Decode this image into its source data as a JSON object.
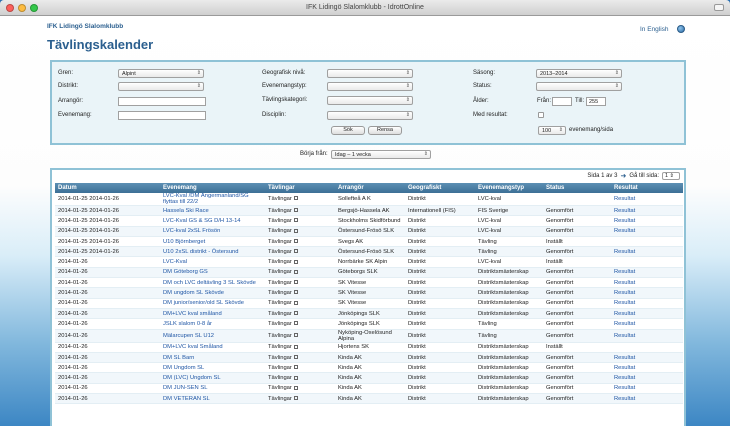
{
  "window": {
    "title": "IFK Lidingö Slalomklubb - IdrottOnline"
  },
  "header": {
    "club": "IFK Lidingö Slalomklubb",
    "page_title": "Tävlingskalender",
    "language_link": "In English"
  },
  "filters": {
    "gren_label": "Gren:",
    "gren_value": "Alpint",
    "distrikt_label": "Distrikt:",
    "arrangor_label": "Arrangör:",
    "evenemang_label": "Evenemang:",
    "geografisk_label": "Geografisk nivå:",
    "evenemangstyp_label": "Evenemangstyp:",
    "tavlingskategori_label": "Tävlingskategori:",
    "disciplin_label": "Disciplin:",
    "sasong_label": "Säsong:",
    "sasong_value": "2013–2014",
    "status_label": "Status:",
    "alder_label": "Ålder:",
    "fran_label": "Från:",
    "till_label": "Till:",
    "till_value": "255",
    "med_resultat_label": "Med resultat:",
    "per_page_value": "100",
    "per_page_label": "evenemang/sida",
    "search_button": "Sök",
    "reset_button": "Rensa"
  },
  "start": {
    "label": "Börja från:",
    "value": "Idag – 1 vecka"
  },
  "pagination": {
    "info": "Sida 1 av 3",
    "goto_label": "Gå till sida:",
    "page_value": "1"
  },
  "table": {
    "headers": [
      "Datum",
      "Evenemang",
      "Tävlingar",
      "Arrangör",
      "Geografiskt",
      "Evenemangstyp",
      "Status",
      "Resultat"
    ],
    "tavlingar_text": "Tävlingar",
    "rows": [
      {
        "date": "2014-01-25 2014-01-26",
        "event": "LVC-Kval /DM Ångermanland/SG flyttas till 22/2",
        "org": "Sollefteå A K",
        "geo": "Distrikt",
        "type": "LVC-kval",
        "status": "",
        "result": "Resultat"
      },
      {
        "date": "2014-01-25 2014-01-26",
        "event": "Hassela Ski Race",
        "org": "Bergsjö-Hassela AK",
        "geo": "Internationell (FIS)",
        "type": "FIS Sverige",
        "status": "Genomfört",
        "result": "Resultat"
      },
      {
        "date": "2014-01-25 2014-01-26",
        "event": "LVC-Kval GS & SG D/H 13-14",
        "org": "Stockholms Skidförbund",
        "geo": "Distrikt",
        "type": "LVC-kval",
        "status": "Genomfört",
        "result": "Resultat"
      },
      {
        "date": "2014-01-25 2014-01-26",
        "event": "LVC-kval 2xSL Frösön",
        "org": "Östersund-Frösö SLK",
        "geo": "Distrikt",
        "type": "LVC-kval",
        "status": "Genomfört",
        "result": "Resultat"
      },
      {
        "date": "2014-01-25 2014-01-26",
        "event": "U10 Björnberget",
        "org": "Svegs AK",
        "geo": "Distrikt",
        "type": "Tävling",
        "status": "Inställt",
        "result": ""
      },
      {
        "date": "2014-01-25 2014-01-26",
        "event": "U10 2xSL distrikt - Östersund",
        "org": "Östersund-Frösö SLK",
        "geo": "Distrikt",
        "type": "Tävling",
        "status": "Genomfört",
        "result": "Resultat"
      },
      {
        "date": "2014-01-26",
        "event": "LVC-Kval",
        "org": "Norrbärke SK Alpin",
        "geo": "Distrikt",
        "type": "LVC-kval",
        "status": "Inställt",
        "result": ""
      },
      {
        "date": "2014-01-26",
        "event": "DM Göteborg GS",
        "org": "Göteborgs SLK",
        "geo": "Distrikt",
        "type": "Distriktsmästerskap",
        "status": "Genomfört",
        "result": "Resultat"
      },
      {
        "date": "2014-01-26",
        "event": "DM och LVC deltävling 3 SL Skövde",
        "org": "SK Vitesse",
        "geo": "Distrikt",
        "type": "Distriktsmästerskap",
        "status": "Genomfört",
        "result": "Resultat"
      },
      {
        "date": "2014-01-26",
        "event": "DM ungdom SL Skövde",
        "org": "SK Vitesse",
        "geo": "Distrikt",
        "type": "Distriktsmästerskap",
        "status": "Genomfört",
        "result": "Resultat"
      },
      {
        "date": "2014-01-26",
        "event": "DM junior/senior/old SL Skövde",
        "org": "SK Vitesse",
        "geo": "Distrikt",
        "type": "Distriktsmästerskap",
        "status": "Genomfört",
        "result": "Resultat"
      },
      {
        "date": "2014-01-26",
        "event": "DM+LVC kval småland",
        "org": "Jönköpings SLK",
        "geo": "Distrikt",
        "type": "Distriktsmästerskap",
        "status": "Genomfört",
        "result": "Resultat"
      },
      {
        "date": "2014-01-26",
        "event": "JSLK slalom 0-8 år",
        "org": "Jönköpings SLK",
        "geo": "Distrikt",
        "type": "Tävling",
        "status": "Genomfört",
        "result": "Resultat"
      },
      {
        "date": "2014-01-26",
        "event": "Mälarcupen SL U12",
        "org": "Nyköping-Oxelösund Alpina",
        "geo": "Distrikt",
        "type": "Tävling",
        "status": "Genomfört",
        "result": "Resultat"
      },
      {
        "date": "2014-01-26",
        "event": "DM+LVC kval Småland",
        "org": "Hjortens SK",
        "geo": "Distrikt",
        "type": "Distriktsmästerskap",
        "status": "Inställt",
        "result": ""
      },
      {
        "date": "2014-01-26",
        "event": "DM SL Barn",
        "org": "Kinda AK",
        "geo": "Distrikt",
        "type": "Distriktsmästerskap",
        "status": "Genomfört",
        "result": "Resultat"
      },
      {
        "date": "2014-01-26",
        "event": "DM Ungdom SL",
        "org": "Kinda AK",
        "geo": "Distrikt",
        "type": "Distriktsmästerskap",
        "status": "Genomfört",
        "result": "Resultat"
      },
      {
        "date": "2014-01-26",
        "event": "DM (LVC) Ungdom SL",
        "org": "Kinda AK",
        "geo": "Distrikt",
        "type": "Distriktsmästerskap",
        "status": "Genomfört",
        "result": "Resultat"
      },
      {
        "date": "2014-01-26",
        "event": "DM JUN-SEN SL",
        "org": "Kinda AK",
        "geo": "Distrikt",
        "type": "Distriktsmästerskap",
        "status": "Genomfört",
        "result": "Resultat"
      },
      {
        "date": "2014-01-26",
        "event": "DM VETERAN SL",
        "org": "Kinda AK",
        "geo": "Distrikt",
        "type": "Distriktsmästerskap",
        "status": "Genomfört",
        "result": "Resultat"
      }
    ]
  },
  "colors": {
    "accent": "#2b5f8f",
    "header_bg": "#4a7ea5",
    "panel_border": "#8fc2d6",
    "link": "#1f56a5"
  }
}
